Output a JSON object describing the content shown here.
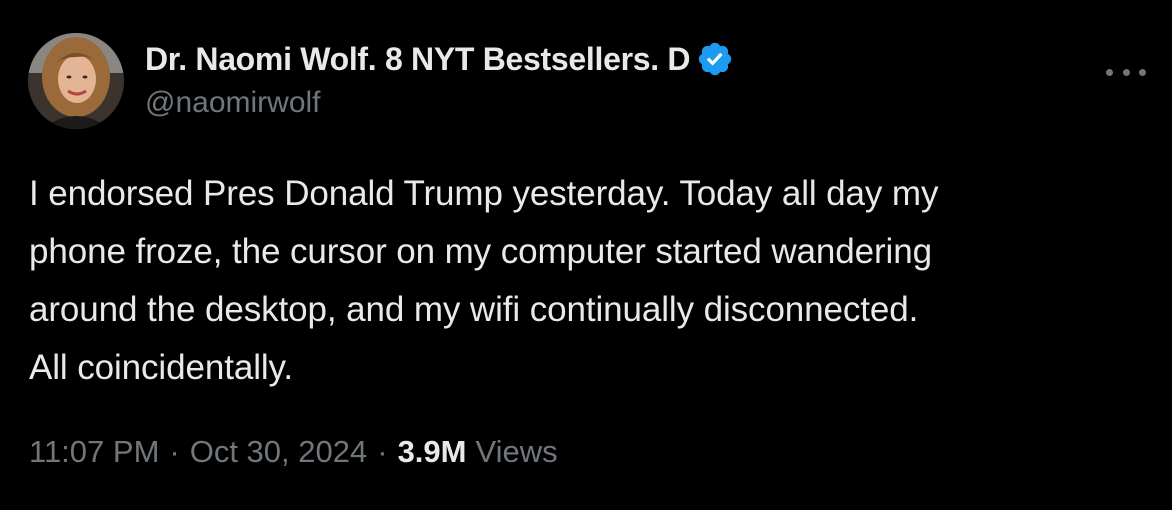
{
  "author": {
    "display_name": "Dr. Naomi Wolf. 8 NYT Bestsellers. D",
    "handle": "@naomirwolf",
    "verified_icon": "verified-badge-icon",
    "verified_color": "#1d9bf0"
  },
  "menu": {
    "icon": "more-options-icon"
  },
  "tweet": {
    "lines": [
      "I endorsed Pres Donald Trump yesterday. Today all day my",
      "phone froze, the cursor on my computer started wandering",
      "around the desktop, and my wifi continually disconnected.",
      "All coincidentally."
    ]
  },
  "meta": {
    "time": "11:07 PM",
    "separator": "·",
    "date": "Oct 30, 2024",
    "views_count": "3.9M",
    "views_label": "Views"
  },
  "colors": {
    "background": "#000000",
    "primary_text": "#e7e9ea",
    "secondary_text": "#71767b",
    "accent": "#1d9bf0"
  }
}
